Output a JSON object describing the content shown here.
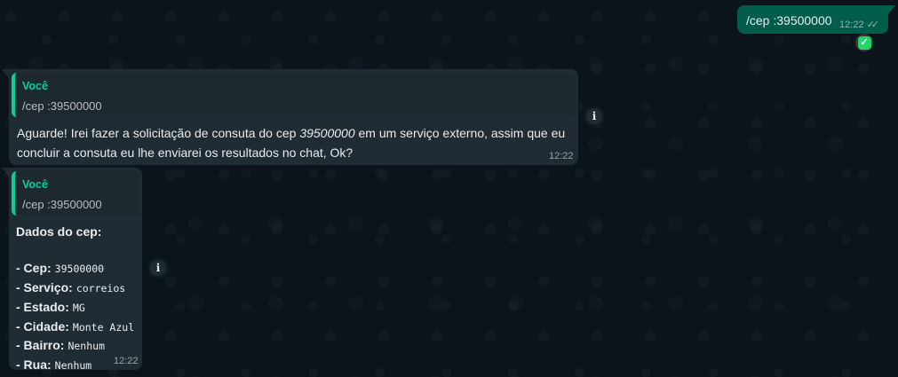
{
  "outgoing": {
    "text": "/cep :39500000",
    "time": "12:22",
    "status_icon": "double-check-icon",
    "reaction_icon": "check-mark-button-icon"
  },
  "message1": {
    "quote_author": "Você",
    "quote_text": "/cep :39500000",
    "text_before": "Aguarde! Irei fazer a solicitação de consuta do cep ",
    "cep": "39500000",
    "text_after": " em um serviço externo, assim que eu concluir a consuta eu lhe enviarei os resultados no chat, Ok?",
    "time": "12:22"
  },
  "message2": {
    "quote_author": "Você",
    "quote_text": "/cep :39500000",
    "heading": "Dados do cep:",
    "fields": [
      {
        "label": "- Cep:",
        "value": "39500000"
      },
      {
        "label": "- Serviço:",
        "value": "correios"
      },
      {
        "label": "- Estado:",
        "value": "MG"
      },
      {
        "label": "- Cidade:",
        "value": "Monte Azul"
      },
      {
        "label": "- Bairro:",
        "value": "Nenhum"
      },
      {
        "label": "- Rua:",
        "value": "Nenhum"
      }
    ],
    "time": "12:22"
  },
  "info_icon": "i",
  "colors": {
    "background": "#0b141a",
    "incoming_bubble": "#202c33",
    "outgoing_bubble": "#005c4b",
    "quote_accent": "#06cf9c"
  }
}
